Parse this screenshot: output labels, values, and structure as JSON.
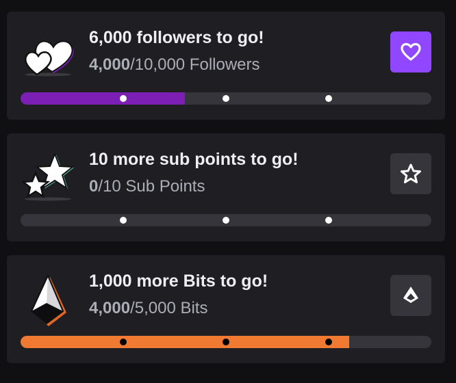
{
  "goals": [
    {
      "id": "followers",
      "title": "6,000 followers to go!",
      "current": "4,000",
      "target_text": "/10,000 Followers",
      "progress_fraction": 0.4,
      "fill_color": "#7b1fb5",
      "icon": "hearts-icon",
      "action_icon": "heart-outline-icon",
      "action_color": "#9147ff"
    },
    {
      "id": "subs",
      "title": "10 more sub points to go!",
      "current": "0",
      "target_text": "/10 Sub Points",
      "progress_fraction": 0,
      "fill_color": "#35353b",
      "icon": "stars-icon",
      "action_icon": "star-outline-icon",
      "action_color": "#35353b"
    },
    {
      "id": "bits",
      "title": "1,000 more Bits to go!",
      "current": "4,000",
      "target_text": "/5,000 Bits",
      "progress_fraction": 0.8,
      "fill_color": "#f07a32",
      "icon": "bits-gem-icon",
      "action_icon": "bits-icon",
      "action_color": "#35353b"
    }
  ],
  "colors": {
    "page_background": "#101012",
    "card_background": "#1f1f23",
    "track": "#35353b",
    "title_text": "#efeff1",
    "subtext": "#adadb8"
  }
}
